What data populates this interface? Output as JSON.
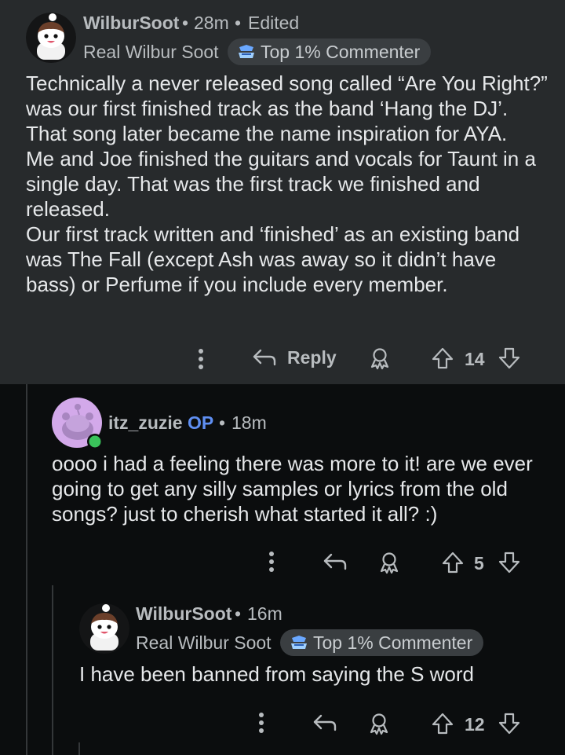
{
  "comments": [
    {
      "username": "WilburSoot",
      "meta_sep": "•",
      "time": "28m",
      "edited_sep": "•",
      "edited": "Edited",
      "flair": "Real Wilbur Soot",
      "badge": "Top 1% Commenter",
      "body": [
        "Technically a never released song called “Are You Right?” was our first finished track as the band ‘Hang the DJ’. That song later became the name inspiration for AYA.",
        "Me and Joe finished the guitars and vocals for Taunt in a single day. That was the first track we finished and released.",
        "Our first track written and ‘finished’ as an existing band was The Fall (except Ash was away so it didn’t have bass) or Perfume if you include every member."
      ],
      "reply_label": "Reply",
      "votes": "14"
    },
    {
      "username": "itz_zuzie",
      "op_tag": "OP",
      "meta_sep": "•",
      "time": "18m",
      "body": "oooo i had a feeling there was more to it! are we ever going to get any silly samples or lyrics from the old songs? just to cherish what started it all? :)",
      "votes": "5"
    },
    {
      "username": "WilburSoot",
      "meta_sep": "•",
      "time": "16m",
      "flair": "Real Wilbur Soot",
      "badge": "Top 1% Commenter",
      "body": "I have been banned from saying the S word",
      "votes": "12"
    }
  ],
  "colors": {
    "background": "#0b0d0e",
    "highlight_panel": "#272a2c",
    "op_accent": "#5f8ff2",
    "online_dot": "#3ac35b",
    "text_muted": "#b8bcbf"
  },
  "icons": [
    "more-vertical-icon",
    "reply-arrow-icon",
    "award-icon",
    "upvote-arrow-icon",
    "downvote-arrow-icon",
    "commenter-badge-icon"
  ]
}
